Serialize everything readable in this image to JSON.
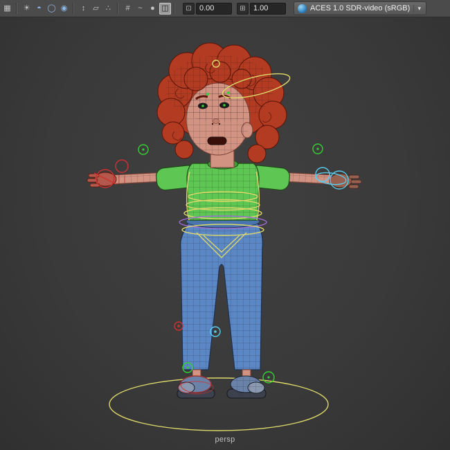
{
  "toolbar": {
    "icons": [
      {
        "type": "icon",
        "name": "app-grid",
        "glyph": "▦"
      },
      {
        "type": "sep"
      },
      {
        "type": "icon",
        "name": "light",
        "glyph": "☀"
      },
      {
        "type": "icon",
        "name": "shaded-sphere",
        "glyph": "◓",
        "tint": "#8fb9e6"
      },
      {
        "type": "icon",
        "name": "wire-sphere",
        "glyph": "◯",
        "tint": "#8fb9e6"
      },
      {
        "type": "icon",
        "name": "textured-sphere",
        "glyph": "◉",
        "tint": "#8fb9e6"
      },
      {
        "type": "sep"
      },
      {
        "type": "icon",
        "name": "select-hierarchy",
        "glyph": "↕"
      },
      {
        "type": "icon",
        "name": "select-object",
        "glyph": "▱"
      },
      {
        "type": "icon",
        "name": "select-component",
        "glyph": "∴"
      },
      {
        "type": "sep"
      },
      {
        "type": "icon",
        "name": "snap-grid",
        "glyph": "#"
      },
      {
        "type": "icon",
        "name": "snap-curve",
        "glyph": "~"
      },
      {
        "type": "icon",
        "name": "snap-point",
        "glyph": "●"
      },
      {
        "type": "icon",
        "name": "snap-plane",
        "glyph": "◫",
        "active": true
      },
      {
        "type": "sep"
      }
    ],
    "fields": [
      {
        "name": "value-a",
        "icon_glyph": "⊡",
        "value": "0.00"
      },
      {
        "name": "value-b",
        "icon_glyph": "⊞",
        "value": "1.00"
      }
    ],
    "color_management": {
      "label": "ACES 1.0 SDR-video (sRGB)",
      "arrow": "▾"
    }
  },
  "viewport": {
    "camera_label": "persp"
  },
  "colors": {
    "toolbar_bg": "#4b4b4b",
    "viewport_bg": "#3a3a3a",
    "viewport_bg_light": "#404040",
    "viewport_bg_dark": "#303030",
    "icon_color": "#c6c6c6",
    "field_bg": "#262626",
    "field_text": "#e6e6e6",
    "dropdown_text": "#f0f0f0",
    "label": "#c2c2c2",
    "hair": "#b23b22",
    "hair_dark": "#5a1408",
    "skin": "#d29383",
    "skin_dark": "#7a4034",
    "shirt": "#5ec653",
    "shirt_dark": "#1e4a16",
    "pants": "#5b87c5",
    "pants_dark": "#1c3050",
    "shoe": "#6a81a8",
    "ctrl_yellow": "#ddd86a",
    "ctrl_green": "#35d035",
    "ctrl_cyan": "#58cdec",
    "ctrl_red": "#d03030",
    "ctrl_purple": "#a06ad8"
  }
}
